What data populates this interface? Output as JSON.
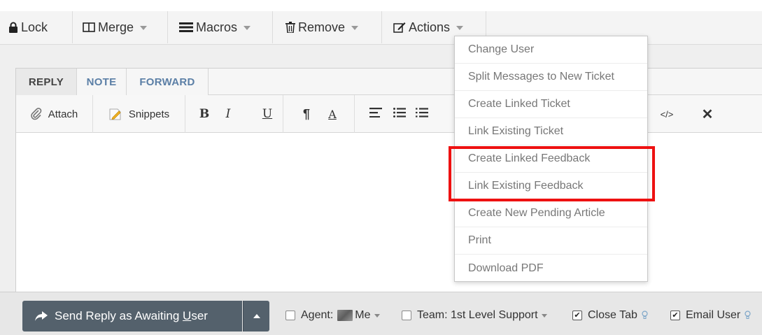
{
  "toolbar": {
    "lock_label": "Lock",
    "merge_label": "Merge",
    "macros_label": "Macros",
    "remove_label": "Remove",
    "actions_label": "Actions"
  },
  "actions_menu": {
    "items": [
      {
        "label": "Change User"
      },
      {
        "label": "Split Messages to New Ticket"
      },
      {
        "label": "Create Linked Ticket"
      },
      {
        "label": "Link Existing Ticket"
      },
      {
        "label": "Create Linked Feedback"
      },
      {
        "label": "Link Existing Feedback"
      },
      {
        "label": "Create New Pending Article"
      },
      {
        "label": "Print"
      },
      {
        "label": "Download PDF"
      }
    ]
  },
  "editor": {
    "tabs": [
      {
        "label": "REPLY",
        "active": true
      },
      {
        "label": "NOTE",
        "active": false
      },
      {
        "label": "FORWARD",
        "active": false
      }
    ],
    "format": {
      "attach_label": "Attach",
      "snippets_label": "Snippets",
      "bold": "B",
      "italic": "I",
      "underline": "U",
      "code": "</>",
      "clear": "✕"
    }
  },
  "bottom": {
    "send_prefix": "Send Reply as Awaiting ",
    "send_underlined": "U",
    "send_suffix": "ser",
    "agent_label": "Agent:",
    "agent_value": "Me",
    "team_label": "Team: 1st Level Support",
    "close_tab_label": "Close Tab",
    "close_tab_checked": true,
    "email_user_label": "Email User",
    "email_user_checked": true
  },
  "colors": {
    "highlight": "#ee1111",
    "send_button": "#54616c",
    "tab_link": "#5b7fa6"
  }
}
